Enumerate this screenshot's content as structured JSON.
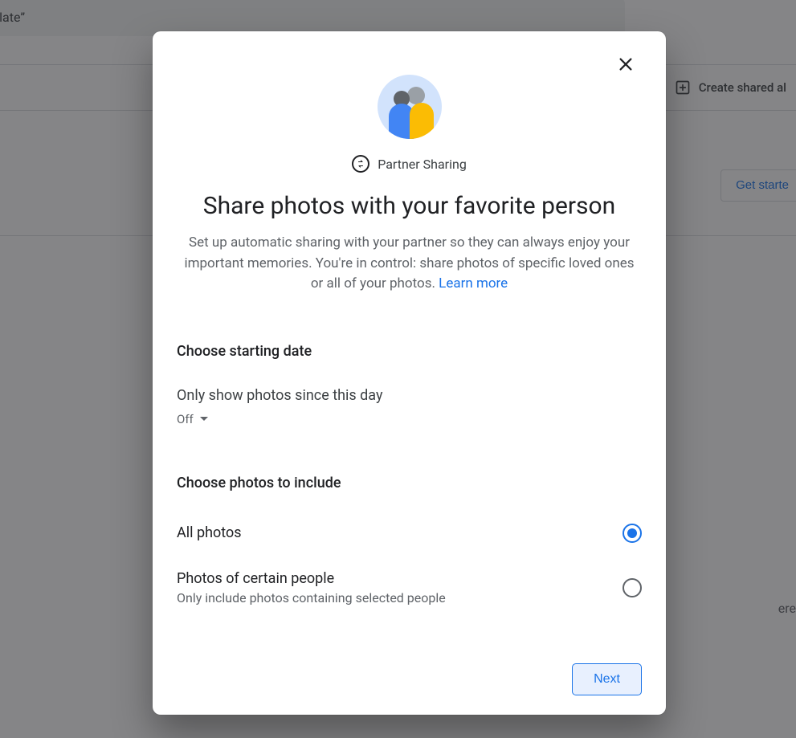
{
  "background": {
    "search_text": "h “Malate”",
    "create_shared_label": "Create shared al",
    "get_started_label": "Get starte",
    "right_text_fragment": "ere"
  },
  "dialog": {
    "subheader_label": "Partner Sharing",
    "title": "Share photos with your favorite person",
    "description": "Set up automatic sharing with your partner so they can always enjoy your important memories. You're in control: share photos of specific loved ones or all of your photos. ",
    "learn_more": "Learn more",
    "section_date_title": "Choose starting date",
    "date_setting_label": "Only show photos since this day",
    "date_dropdown_value": "Off",
    "section_photos_title": "Choose photos to include",
    "options": [
      {
        "primary": "All photos",
        "secondary": "",
        "selected": true
      },
      {
        "primary": "Photos of certain people",
        "secondary": "Only include photos containing selected people",
        "selected": false
      }
    ],
    "next_label": "Next"
  }
}
